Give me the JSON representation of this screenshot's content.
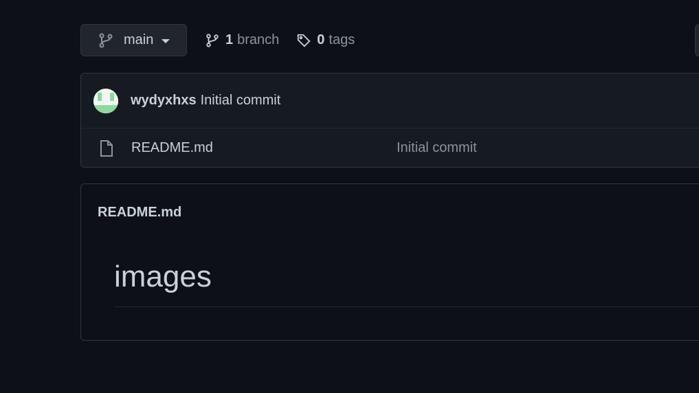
{
  "branch_bar": {
    "current_branch": "main",
    "branch_count": "1",
    "branch_label": "branch",
    "tag_count": "0",
    "tag_label": "tags"
  },
  "latest_commit": {
    "author": "wydyxhxs",
    "message": "Initial commit"
  },
  "files": [
    {
      "name": "README.md",
      "last_commit": "Initial commit",
      "icon": "file-icon"
    }
  ],
  "readme": {
    "title": "README.md",
    "heading": "images"
  },
  "colors": {
    "background": "#0d1117",
    "panel": "#161b22",
    "border": "#30363d",
    "text": "#c9d1d9",
    "muted": "#8b949e",
    "avatar_green": "#8ddb9c"
  }
}
